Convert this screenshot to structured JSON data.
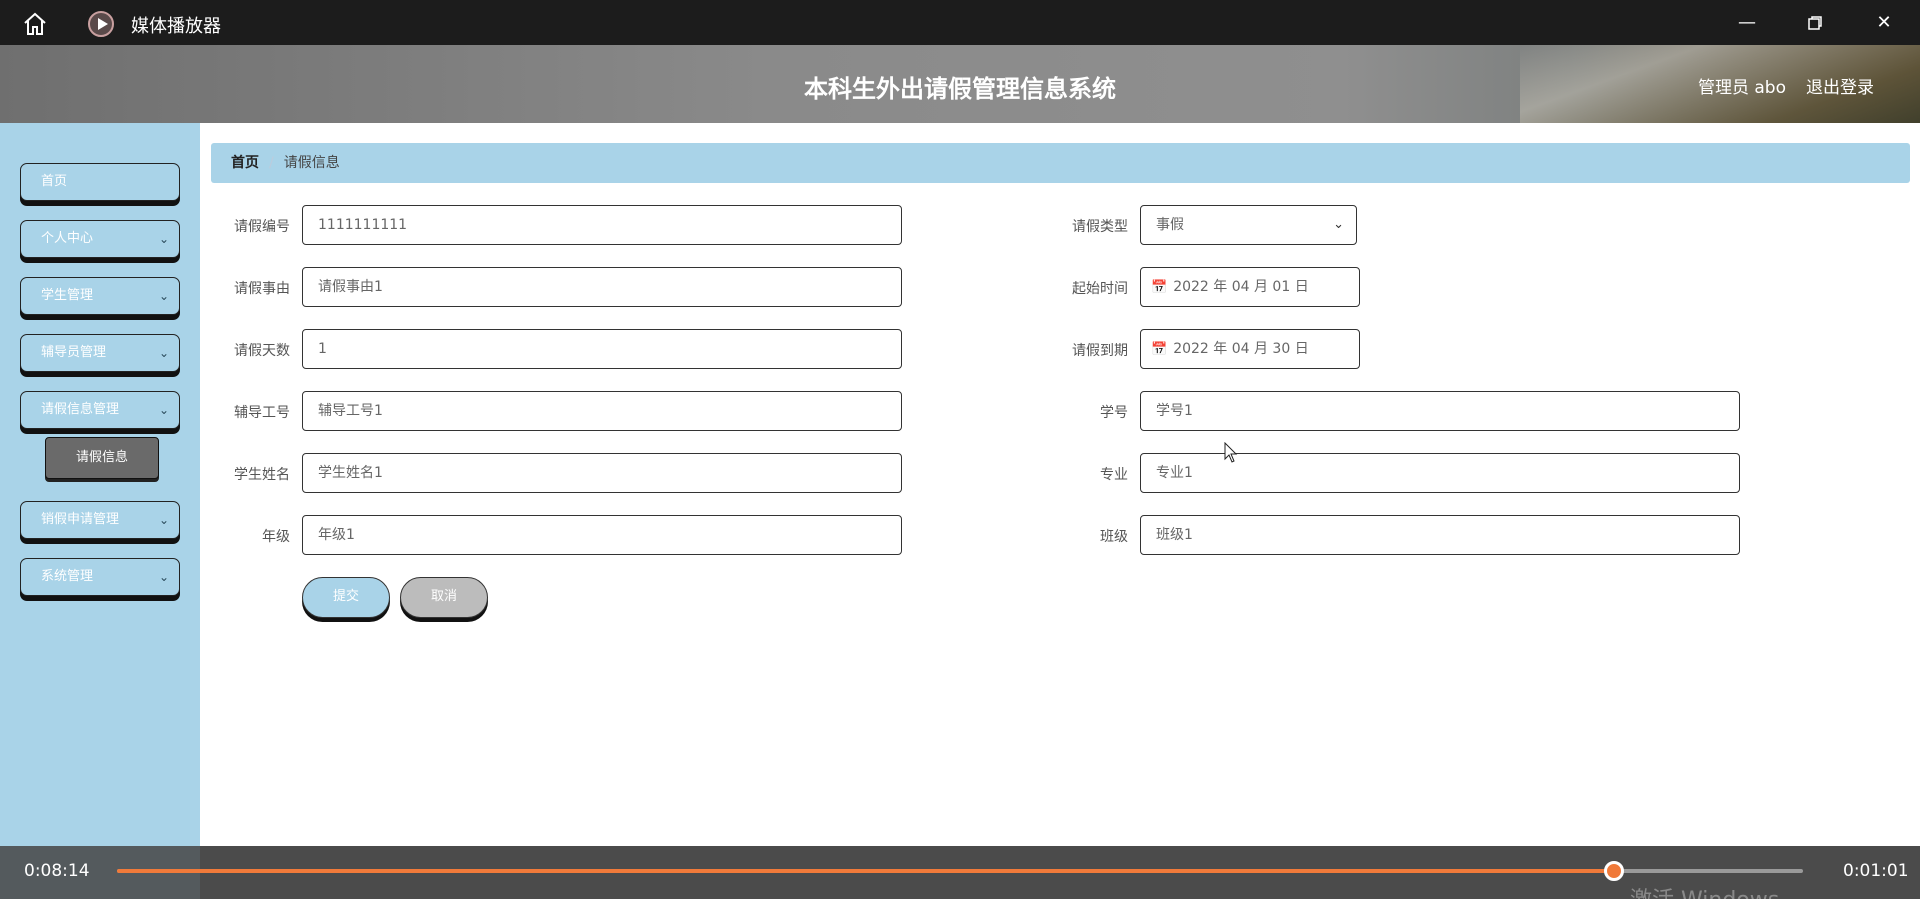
{
  "player": {
    "title": "媒体播放器",
    "time_elapsed": "0:08:14",
    "time_remaining": "0:01:01",
    "progress": 0.888,
    "watermark": "激活 Windows",
    "accent": "#f07a3a"
  },
  "header": {
    "title": "本科生外出请假管理信息系统",
    "user": "管理员 abo",
    "logout": "退出登录"
  },
  "sidebar": {
    "items": [
      {
        "label": "首页"
      },
      {
        "label": "个人中心"
      },
      {
        "label": "学生管理"
      },
      {
        "label": "辅导员管理"
      },
      {
        "label": "请假信息管理"
      },
      {
        "label": "销假申请管理"
      },
      {
        "label": "系统管理"
      }
    ],
    "submenu": {
      "label": "请假信息"
    },
    "background": "#a9d3e8"
  },
  "breadcrumb": {
    "home": "首页",
    "separator": "/",
    "current": "请假信息"
  },
  "form": {
    "leave_no": {
      "label": "请假编号",
      "value": "1111111111"
    },
    "leave_reason": {
      "label": "请假事由",
      "value": "请假事由1"
    },
    "leave_days": {
      "label": "请假天数",
      "value": "1"
    },
    "counselor_no": {
      "label": "辅导工号",
      "value": "辅导工号1"
    },
    "student_name": {
      "label": "学生姓名",
      "value": "学生姓名1"
    },
    "grade": {
      "label": "年级",
      "value": "年级1"
    },
    "leave_type": {
      "label": "请假类型",
      "value": "事假"
    },
    "start_time": {
      "label": "起始时间",
      "value": "2022 年 04 月 01 日"
    },
    "end_time": {
      "label": "请假到期",
      "value": "2022 年 04 月 30 日"
    },
    "student_no": {
      "label": "学号",
      "value": "学号1"
    },
    "major": {
      "label": "专业",
      "value": "专业1"
    },
    "class": {
      "label": "班级",
      "value": "班级1"
    }
  },
  "buttons": {
    "submit": "提交",
    "cancel": "取消"
  }
}
